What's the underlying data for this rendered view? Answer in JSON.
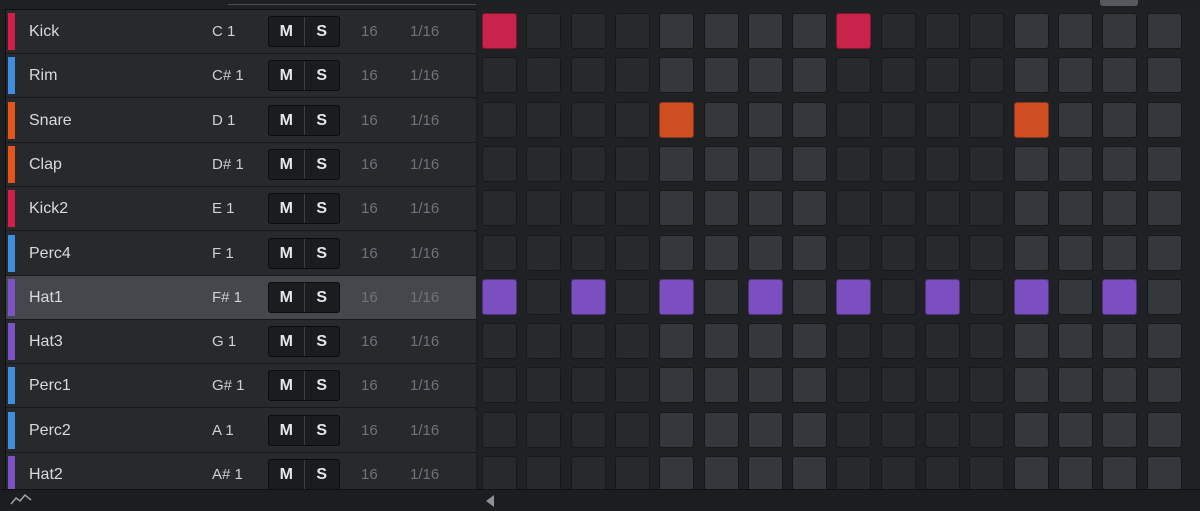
{
  "tracks": [
    {
      "name": "Kick",
      "note": "C 1",
      "mute_label": "M",
      "solo_label": "S",
      "steps": "16",
      "resolution": "1/16",
      "color": "#d11e4b",
      "active_color": "#c8234a",
      "selected": false,
      "active_steps": [
        0,
        8
      ]
    },
    {
      "name": "Rim",
      "note": "C# 1",
      "mute_label": "M",
      "solo_label": "S",
      "steps": "16",
      "resolution": "1/16",
      "color": "#3d8fe0",
      "active_color": "#3d8fe0",
      "selected": false,
      "active_steps": []
    },
    {
      "name": "Snare",
      "note": "D 1",
      "mute_label": "M",
      "solo_label": "S",
      "steps": "16",
      "resolution": "1/16",
      "color": "#e4541b",
      "active_color": "#cf4f22",
      "selected": false,
      "active_steps": [
        4,
        12
      ]
    },
    {
      "name": "Clap",
      "note": "D# 1",
      "mute_label": "M",
      "solo_label": "S",
      "steps": "16",
      "resolution": "1/16",
      "color": "#e4541b",
      "active_color": "#cf4f22",
      "selected": false,
      "active_steps": []
    },
    {
      "name": "Kick2",
      "note": "E 1",
      "mute_label": "M",
      "solo_label": "S",
      "steps": "16",
      "resolution": "1/16",
      "color": "#d11e4b",
      "active_color": "#c8234a",
      "selected": false,
      "active_steps": []
    },
    {
      "name": "Perc4",
      "note": "F 1",
      "mute_label": "M",
      "solo_label": "S",
      "steps": "16",
      "resolution": "1/16",
      "color": "#3d8fe0",
      "active_color": "#3d8fe0",
      "selected": false,
      "active_steps": []
    },
    {
      "name": "Hat1",
      "note": "F# 1",
      "mute_label": "M",
      "solo_label": "S",
      "steps": "16",
      "resolution": "1/16",
      "color": "#7d52c2",
      "active_color": "#7b4fc0",
      "selected": true,
      "active_steps": [
        0,
        2,
        4,
        6,
        8,
        10,
        12,
        14
      ]
    },
    {
      "name": "Hat3",
      "note": "G 1",
      "mute_label": "M",
      "solo_label": "S",
      "steps": "16",
      "resolution": "1/16",
      "color": "#7d52c2",
      "active_color": "#7b4fc0",
      "selected": false,
      "active_steps": []
    },
    {
      "name": "Perc1",
      "note": "G# 1",
      "mute_label": "M",
      "solo_label": "S",
      "steps": "16",
      "resolution": "1/16",
      "color": "#3d8fe0",
      "active_color": "#3d8fe0",
      "selected": false,
      "active_steps": []
    },
    {
      "name": "Perc2",
      "note": "A 1",
      "mute_label": "M",
      "solo_label": "S",
      "steps": "16",
      "resolution": "1/16",
      "color": "#3d8fe0",
      "active_color": "#3d8fe0",
      "selected": false,
      "active_steps": []
    },
    {
      "name": "Hat2",
      "note": "A# 1",
      "mute_label": "M",
      "solo_label": "S",
      "steps": "16",
      "resolution": "1/16",
      "color": "#7d52c2",
      "active_color": "#7b4fc0",
      "selected": false,
      "active_steps": []
    }
  ],
  "grid": {
    "step_count": 16,
    "beat_group": 4
  },
  "icons": {
    "automation": "automation-graph-icon",
    "scroll_left": "scroll-left-arrow-icon"
  }
}
